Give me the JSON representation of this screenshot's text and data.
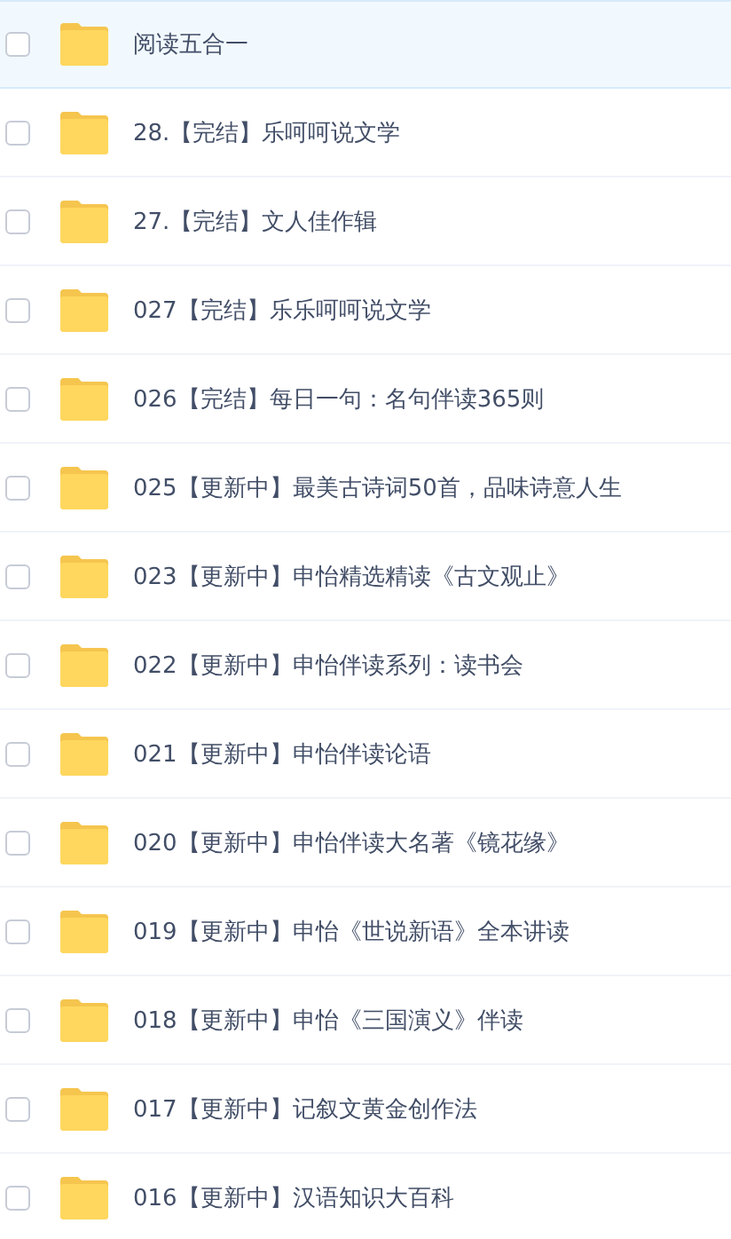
{
  "files": [
    {
      "name": "阅读五合一",
      "selected": true,
      "checked": false
    },
    {
      "name": "28.【完结】乐呵呵说文学",
      "selected": false,
      "checked": false
    },
    {
      "name": "27.【完结】文人佳作辑",
      "selected": false,
      "checked": false
    },
    {
      "name": "027【完结】乐乐呵呵说文学",
      "selected": false,
      "checked": false
    },
    {
      "name": "026【完结】每日一句：名句伴读365则",
      "selected": false,
      "checked": false
    },
    {
      "name": "025【更新中】最美古诗词50首，品味诗意人生",
      "selected": false,
      "checked": false
    },
    {
      "name": "023【更新中】申怡精选精读《古文观止》",
      "selected": false,
      "checked": false
    },
    {
      "name": "022【更新中】申怡伴读系列：读书会",
      "selected": false,
      "checked": false
    },
    {
      "name": "021【更新中】申怡伴读论语",
      "selected": false,
      "checked": false
    },
    {
      "name": "020【更新中】申怡伴读大名著《镜花缘》",
      "selected": false,
      "checked": false
    },
    {
      "name": "019【更新中】申怡《世说新语》全本讲读",
      "selected": false,
      "checked": false
    },
    {
      "name": "018【更新中】申怡《三国演义》伴读",
      "selected": false,
      "checked": false
    },
    {
      "name": "017【更新中】记叙文黄金创作法",
      "selected": false,
      "checked": false
    },
    {
      "name": "016【更新中】汉语知识大百科",
      "selected": false,
      "checked": false
    }
  ]
}
